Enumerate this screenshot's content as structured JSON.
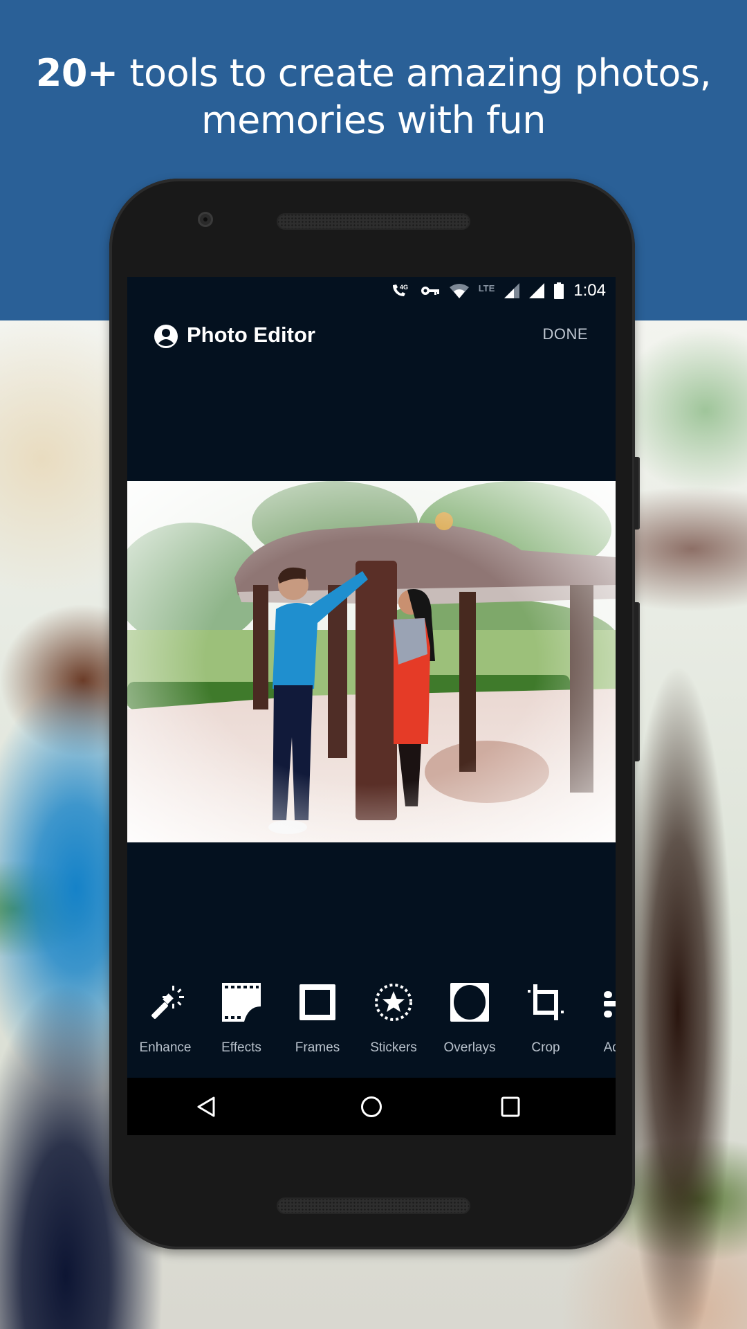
{
  "promo": {
    "headline_bold": "20+",
    "headline_rest": " tools to create amazing photos,",
    "headline_line2": "memories with fun"
  },
  "status_bar": {
    "icons": [
      "hd-call-4g-icon",
      "vpn-key-icon",
      "wifi-icon",
      "lte-signal-icon",
      "signal-icon",
      "battery-icon"
    ],
    "lte_label": "LTE",
    "time": "1:04"
  },
  "app_bar": {
    "title": "Photo Editor",
    "icon": "account-circle-icon",
    "done_label": "DONE"
  },
  "photo": {
    "description": "Couple posing at a park gazebo pillar with vignette effect"
  },
  "tools": [
    {
      "label": "Enhance",
      "icon": "magic-wand-icon"
    },
    {
      "label": "Effects",
      "icon": "film-effects-icon"
    },
    {
      "label": "Frames",
      "icon": "frame-icon"
    },
    {
      "label": "Stickers",
      "icon": "sticker-star-icon"
    },
    {
      "label": "Overlays",
      "icon": "overlay-icon"
    },
    {
      "label": "Crop",
      "icon": "crop-icon"
    },
    {
      "label": "Adjust",
      "icon": "adjust-icon",
      "visible_label": "Ad"
    }
  ],
  "nav_bar": {
    "buttons": [
      "back-icon",
      "home-icon",
      "recents-icon"
    ]
  },
  "colors": {
    "brand_blue": "#2a6097",
    "screen_bg": "#04111f",
    "phone_body": "#191919"
  }
}
